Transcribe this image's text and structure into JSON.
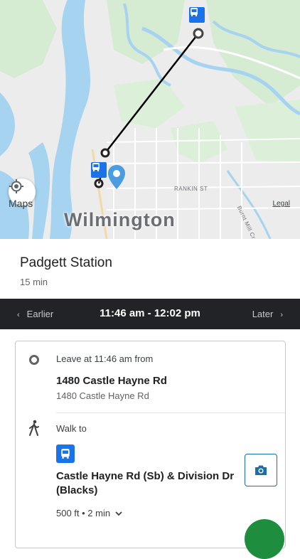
{
  "map": {
    "city_label": "Wilmington",
    "street_labels": [
      "RANKIN ST",
      "Burnt Mill Creek"
    ],
    "attribution": "Maps",
    "legal_label": "Legal"
  },
  "destination": {
    "name": "Padgett Station",
    "duration": "15 min"
  },
  "time_bar": {
    "earlier_label": "Earlier",
    "time_range": "11:46 am - 12:02 pm",
    "later_label": "Later"
  },
  "itinerary": {
    "leave_text": "Leave at 11:46 am from",
    "origin_name": "1480 Castle Hayne Rd",
    "origin_address": "1480 Castle Hayne Rd",
    "walk_label": "Walk to",
    "stop_name": "Castle Hayne Rd (Sb) & Division Dr (Blacks)",
    "walk_distance": "500 ft • 2 min"
  },
  "colors": {
    "accent_blue": "#1a73e8",
    "pin_blue": "#4a9de0",
    "time_bar_bg": "#222326",
    "fab_green": "#1e8e3e",
    "water": "#a5d3f0",
    "park": "#d5ebd2"
  },
  "icons": [
    "locate-icon",
    "bus-icon",
    "location-pin-icon",
    "origin-circle-icon",
    "walk-icon",
    "camera-icon",
    "chevron-left-icon",
    "chevron-right-icon",
    "chevron-down-icon"
  ]
}
